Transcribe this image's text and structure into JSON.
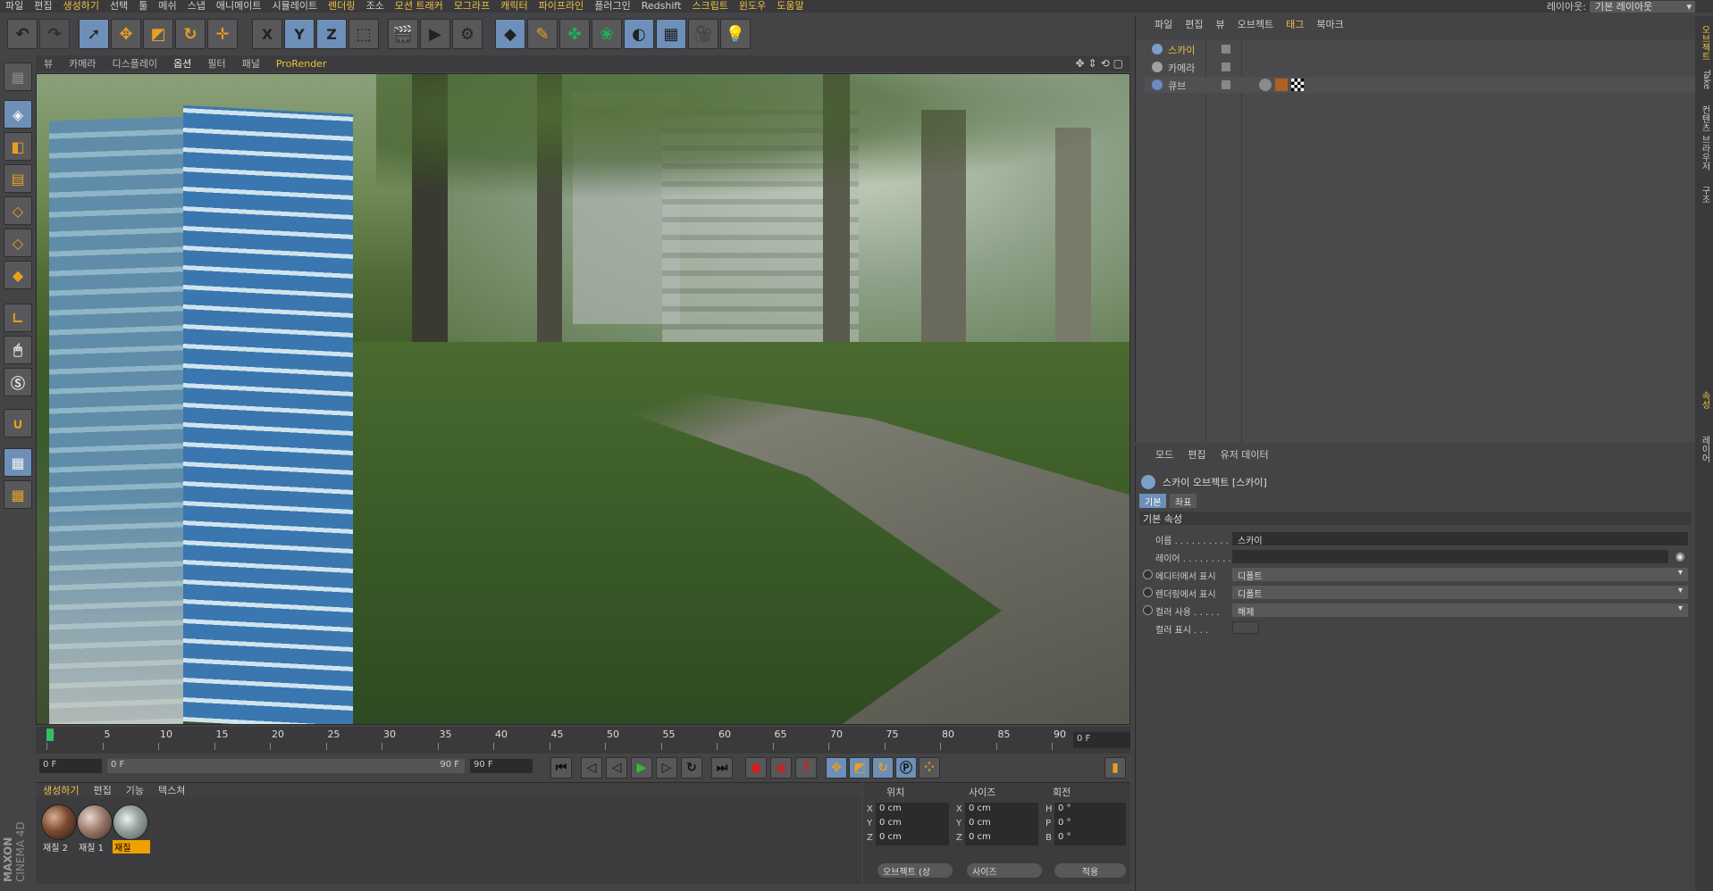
{
  "menubar": {
    "items": [
      "파일",
      "편집",
      "생성하기",
      "선택",
      "툴",
      "메쉬",
      "스냅",
      "애니메이트",
      "시뮬레이트",
      "렌더링",
      "조소",
      "모션 트래커",
      "모그라프",
      "캐릭터",
      "파이프라인",
      "플러그인",
      "Redshift",
      "스크립트",
      "윈도우",
      "도움말"
    ],
    "highlighted": [
      "생성하기",
      "렌더링",
      "모션 트래커",
      "모그라프",
      "캐릭터",
      "파이프라인",
      "스크립트",
      "윈도우",
      "도움말"
    ],
    "layout_label": "레이아웃:",
    "layout_value": "기본 레이아웃"
  },
  "toolbar": {
    "x_label": "X",
    "y_label": "Y",
    "z_label": "Z"
  },
  "viewport_menu": {
    "items": [
      "뷰",
      "카메라",
      "디스플레이",
      "옵션",
      "필터",
      "패널",
      "ProRender"
    ]
  },
  "timeline": {
    "tick_labels": [
      "0",
      "5",
      "10",
      "15",
      "20",
      "25",
      "30",
      "35",
      "40",
      "45",
      "50",
      "55",
      "60",
      "65",
      "70",
      "75",
      "80",
      "85",
      "90"
    ],
    "frame_readout": "0 F"
  },
  "transport": {
    "start_field": "0 F",
    "range_start": "0 F",
    "range_end": "90 F",
    "end_field": "90 F"
  },
  "material_panel": {
    "menu": [
      "생성하기",
      "편집",
      "기능",
      "텍스쳐"
    ],
    "materials": [
      {
        "label": "재질 2",
        "selected": false
      },
      {
        "label": "재질 1",
        "selected": false
      },
      {
        "label": "재질",
        "selected": true
      }
    ]
  },
  "coord_panel": {
    "headers": {
      "position": "위치",
      "size": "사이즈",
      "rotation": "회전"
    },
    "rows": [
      {
        "axis": "X",
        "pos": "0 cm",
        "size_axis": "X",
        "size": "0 cm",
        "rot_axis": "H",
        "rot": "0 °"
      },
      {
        "axis": "Y",
        "pos": "0 cm",
        "size_axis": "Y",
        "size": "0 cm",
        "rot_axis": "P",
        "rot": "0 °"
      },
      {
        "axis": "Z",
        "pos": "0 cm",
        "size_axis": "Z",
        "size": "0 cm",
        "rot_axis": "B",
        "rot": "0 °"
      }
    ],
    "object_drop": "오브젝트 (상",
    "size_drop": "사이즈",
    "apply_button": "적용"
  },
  "logo": {
    "maxon": "MAXON",
    "product": "CINEMA 4D"
  },
  "object_manager": {
    "menu": [
      "파일",
      "편집",
      "뷰",
      "오브젝트",
      "태그",
      "북마크"
    ],
    "objects": [
      {
        "name": "스카이",
        "selected": true
      },
      {
        "name": "카메라",
        "selected": false
      },
      {
        "name": "큐브",
        "selected": false
      }
    ]
  },
  "attribute_manager": {
    "menu": [
      "모드",
      "편집",
      "유저 데이터"
    ],
    "title": "스카이 오브젝트 [스카이]",
    "tabs": [
      {
        "label": "기본",
        "active": true
      },
      {
        "label": "좌표",
        "active": false
      }
    ],
    "section": "기본 속성",
    "fields": [
      {
        "label": "이름 . . . . . . . . . .",
        "value": "스카이",
        "type": "text",
        "radio": false
      },
      {
        "label": "레이어 . . . . . . . . .",
        "value": "",
        "type": "text",
        "radio": false
      },
      {
        "label": "에디터에서 표시",
        "value": "디폴트",
        "type": "drop",
        "radio": true
      },
      {
        "label": "렌더링에서 표시",
        "value": "디폴트",
        "type": "drop",
        "radio": true
      },
      {
        "label": "컬러 사용 . . . . .",
        "value": "해제",
        "type": "drop",
        "radio": true
      },
      {
        "label": "컬러 표시 . . .",
        "value": "",
        "type": "swatch",
        "radio": false
      }
    ]
  },
  "right_strip": {
    "tabs": [
      "오브젝트",
      "Take",
      "컨텐츠 브라우저",
      "구조",
      "속성",
      "레이어"
    ]
  },
  "colors": {
    "accent": "#f0c040",
    "selected_blue": "#6d8fb8",
    "panel_bg": "#444446"
  }
}
